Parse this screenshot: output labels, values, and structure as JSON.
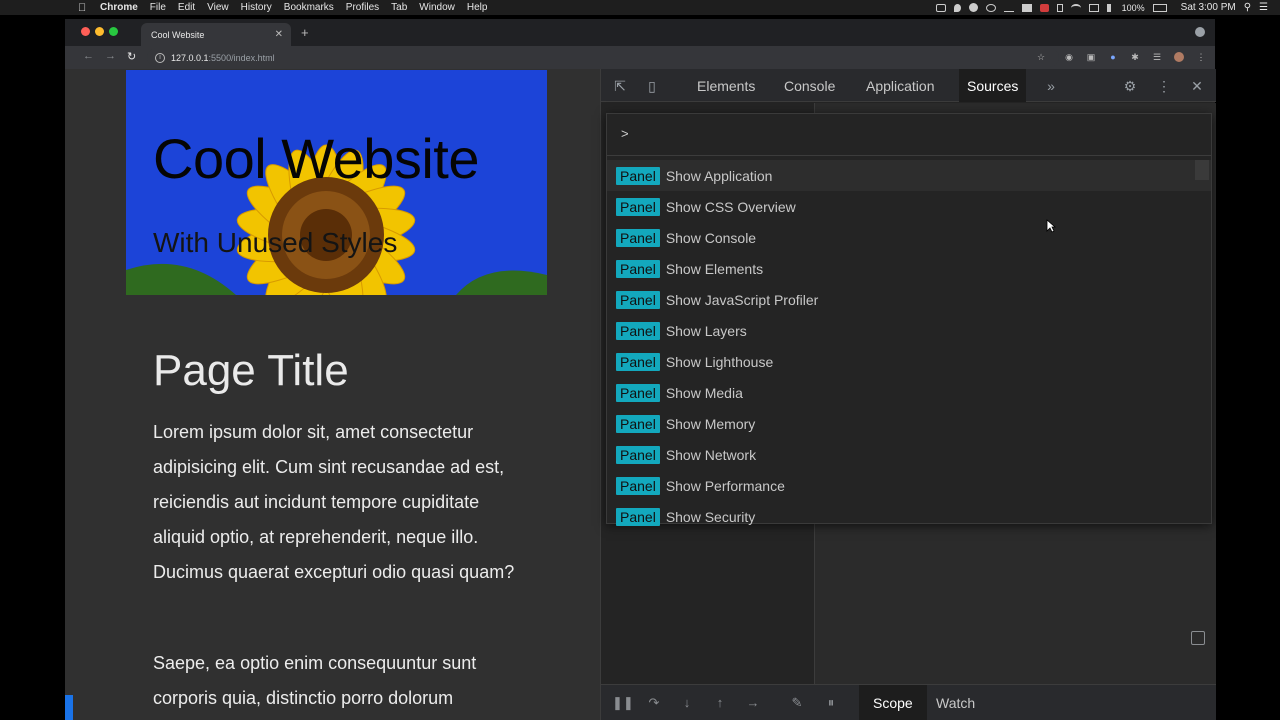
{
  "menubar": {
    "items": [
      "Chrome",
      "File",
      "Edit",
      "View",
      "History",
      "Bookmarks",
      "Profiles",
      "Tab",
      "Window",
      "Help"
    ],
    "battery": "100%",
    "clock": "Sat 3:00 PM"
  },
  "browser": {
    "tab_title": "Cool Website",
    "url_host": "127.0.0.1",
    "url_path": ":5500/index.html"
  },
  "page": {
    "hero_title": "Cool Website",
    "hero_subtitle": "With Unused Styles",
    "title": "Page Title",
    "paragraph1": "Lorem ipsum dolor sit, amet consectetur adipisicing elit. Cum sint recusandae ad est, reiciendis aut incidunt tempore cupiditate aliquid optio, at reprehenderit, neque illo. Ducimus quaerat excepturi odio quasi quam?",
    "paragraph2": "Saepe, ea optio enim consequuntur sunt corporis quia, distinctio porro dolorum"
  },
  "devtools": {
    "tabs": [
      "Elements",
      "Console",
      "Application",
      "Sources"
    ],
    "active_tab": "Sources",
    "command_prompt": ">",
    "badge_label": "Panel",
    "commands": [
      "Show Application",
      "Show CSS Overview",
      "Show Console",
      "Show Elements",
      "Show JavaScript Profiler",
      "Show Layers",
      "Show Lighthouse",
      "Show Media",
      "Show Memory",
      "Show Network",
      "Show Performance",
      "Show Security"
    ],
    "bottom_tabs": [
      "Scope",
      "Watch"
    ]
  },
  "colors": {
    "badge": "#13a8bd",
    "page_bg": "#303030",
    "hero_sky": "#1c44d8",
    "sunflower": "#f2c400"
  }
}
